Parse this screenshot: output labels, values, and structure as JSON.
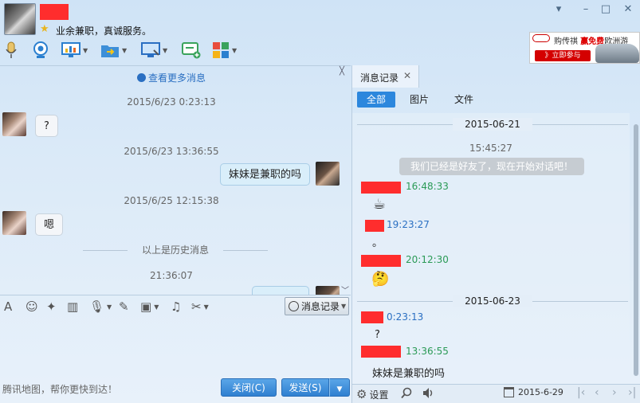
{
  "header": {
    "signature": "业余兼职，真诚服务。"
  },
  "ad": {
    "line1_prefix": "购传祺",
    "line1_highlight": "赢免费",
    "line1_suffix": "欧洲游",
    "button": "》立即参与"
  },
  "chat": {
    "more_link": "查看更多消息",
    "messages": [
      {
        "time": "2015/6/23 0:23:13",
        "text": "?"
      },
      {
        "time": "2015/6/23 13:36:55",
        "text": "妹妹是兼职的吗"
      },
      {
        "time": "2015/6/25 12:15:38",
        "text": "嗯"
      }
    ],
    "history_divider": "以上是历史消息",
    "latest_time": "21:36:07"
  },
  "input": {
    "history_button": "消息记录",
    "footer_hint": "腾讯地图，帮你更快到达！",
    "close_button": "关闭(C)",
    "send_button": "发送(S)"
  },
  "records": {
    "tab_label": "消息记录",
    "filters": [
      "全部",
      "图片",
      "文件"
    ],
    "date1": "2015-06-21",
    "time_center": "15:45:27",
    "system_msg": "我们已经是好友了，现在开始对话吧！",
    "entries1": [
      {
        "time": "16:48:33"
      },
      {
        "time": "19:23:27",
        "text": "。"
      },
      {
        "time": "20:12:30"
      }
    ],
    "date2": "2015-06-23",
    "entries2": [
      {
        "time": "0:23:13",
        "text": "?"
      },
      {
        "time": "13:36:55",
        "text": "妹妹是兼职的吗"
      }
    ],
    "settings_label": "设置",
    "date_display": "2015-6-29"
  }
}
